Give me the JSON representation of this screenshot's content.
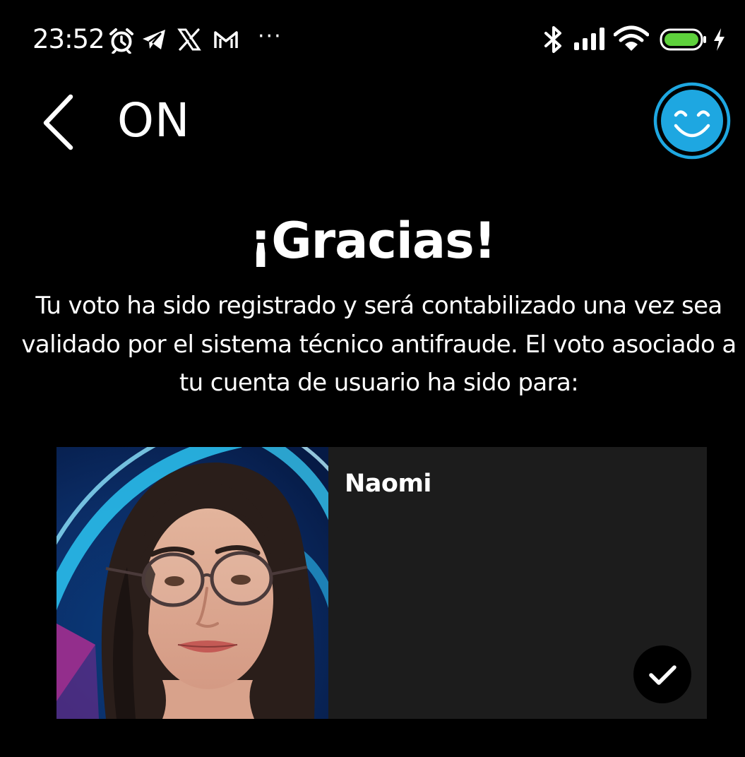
{
  "status_bar": {
    "time": "23:52",
    "dots": "···",
    "icons": [
      "alarm-icon",
      "telegram-icon",
      "x-icon",
      "gmail-icon",
      "bluetooth-icon",
      "signal-icon",
      "wifi-icon",
      "battery-icon",
      "charging-icon"
    ],
    "battery_level": 1.0
  },
  "header": {
    "title": "ON",
    "back_icon": "chevron-left-icon",
    "avatar_icon": "smiley-face-icon"
  },
  "main": {
    "title": "¡Gracias!",
    "message": "Tu voto ha sido registrado y será contabilizado una vez sea validado por el sistema técnico antifraude. El voto asociado a tu cuenta de usuario ha sido para:"
  },
  "vote_card": {
    "candidate_name": "Naomi",
    "selected_icon": "checkmark-icon"
  },
  "colors": {
    "background": "#000000",
    "text": "#ffffff",
    "card_background": "#1c1c1c",
    "accent": "#1ea7e1",
    "battery": "#5ed13c"
  }
}
